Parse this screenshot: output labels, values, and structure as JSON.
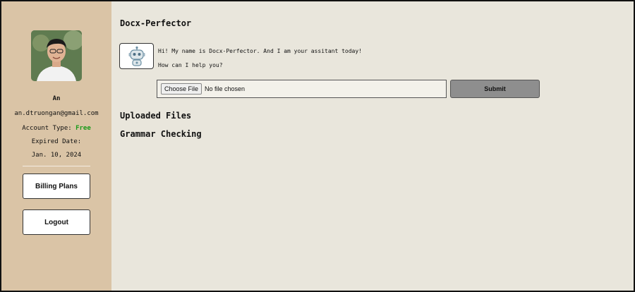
{
  "sidebar": {
    "user_name": "An",
    "email": "an.dtruongan@gmail.com",
    "account_type_label": "Account Type:",
    "account_type_value": "Free",
    "expired_label": "Expired Date:",
    "expired_date": "Jan. 10, 2024",
    "billing_label": "Billing Plans",
    "logout_label": "Logout"
  },
  "main": {
    "title": "Docx-Perfector",
    "bot_icon": "robot-icon",
    "greeting": "Hi! My name is Docx-Perfector. And I am your assitant today!",
    "help": "How can I help you?",
    "choose_file_label": "Choose File",
    "file_status": "No file chosen",
    "submit_label": "Submit",
    "uploaded_heading": "Uploaded Files",
    "grammar_heading": "Grammar Checking"
  },
  "colors": {
    "sidebar_bg": "#dac4a6",
    "main_bg": "#e9e6dc",
    "plan_free": "#1a9a1a",
    "submit_bg": "#8e8e8e"
  }
}
